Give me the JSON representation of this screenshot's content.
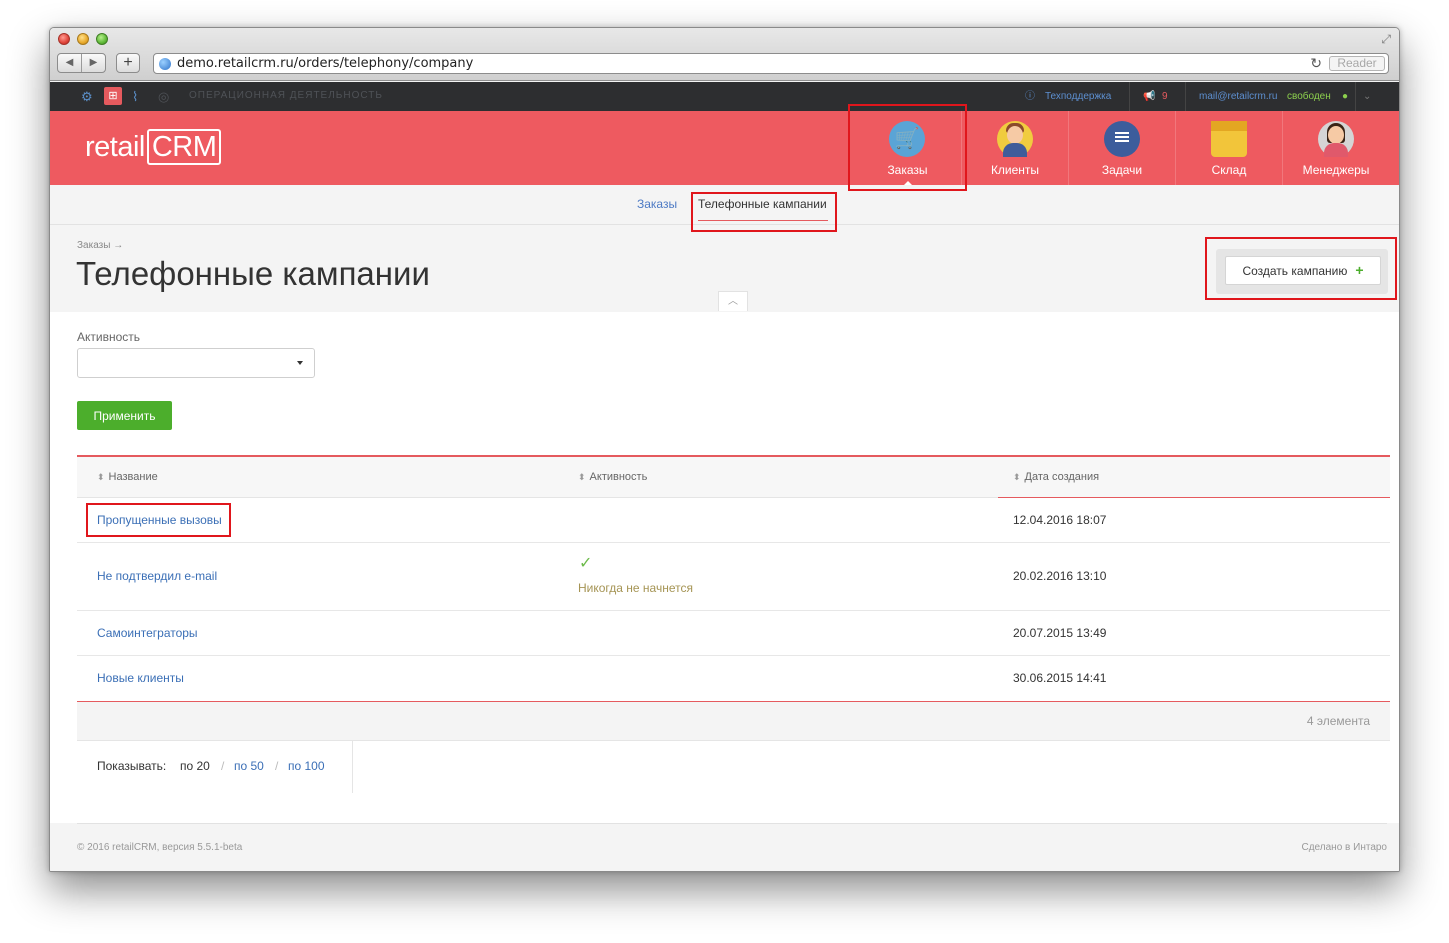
{
  "browser": {
    "url": "demo.retailcrm.ru/orders/telephony/company",
    "reader_label": "Reader"
  },
  "topbar": {
    "section_label": "ОПЕРАЦИОННАЯ ДЕЯТЕЛЬНОСТЬ",
    "support_label": "Техподдержка",
    "notifications_count": "9",
    "user_email": "mail@retailcrm.ru",
    "user_status": "свободен"
  },
  "header": {
    "logo_prefix": "retail",
    "logo_box": "CRM",
    "modules": [
      {
        "label": "Заказы",
        "icon": "cart-icon"
      },
      {
        "label": "Клиенты",
        "icon": "client-icon"
      },
      {
        "label": "Задачи",
        "icon": "tasks-icon"
      },
      {
        "label": "Склад",
        "icon": "warehouse-icon"
      },
      {
        "label": "Менеджеры",
        "icon": "manager-icon"
      }
    ]
  },
  "subnav": {
    "orders_link": "Заказы",
    "active_tab": "Телефонные кампании"
  },
  "page": {
    "breadcrumb": "Заказы →",
    "title": "Телефонные кампании",
    "create_button": "Создать кампанию"
  },
  "filter": {
    "activity_label": "Активность",
    "activity_value": "",
    "apply_button": "Применить"
  },
  "table": {
    "headers": [
      "Название",
      "Активность",
      "Дата создания"
    ],
    "rows": [
      {
        "name": "Пропущенные вызовы",
        "activity": "",
        "date": "12.04.2016 18:07"
      },
      {
        "name": "Не подтвердил e-mail",
        "activity": "Никогда не начнется",
        "date": "20.02.2016 13:10"
      },
      {
        "name": "Самоинтеграторы",
        "activity": "",
        "date": "20.07.2015 13:49"
      },
      {
        "name": "Новые клиенты",
        "activity": "",
        "date": "30.06.2015 14:41"
      }
    ],
    "count_text": "4  элемента",
    "show_label": "Показывать:",
    "page_sizes": [
      "по 20",
      "по 50",
      "по 100"
    ],
    "page_size_separator": "/"
  },
  "footer": {
    "copyright": "© 2016 retailCRM, версия 5.5.1-beta",
    "made_by": "Сделано в Интаро"
  },
  "colors": {
    "brand_red": "#ee5a60",
    "link_blue": "#3b6fb6",
    "apply_green": "#4cae2c",
    "highlight_red": "#e0161c"
  }
}
